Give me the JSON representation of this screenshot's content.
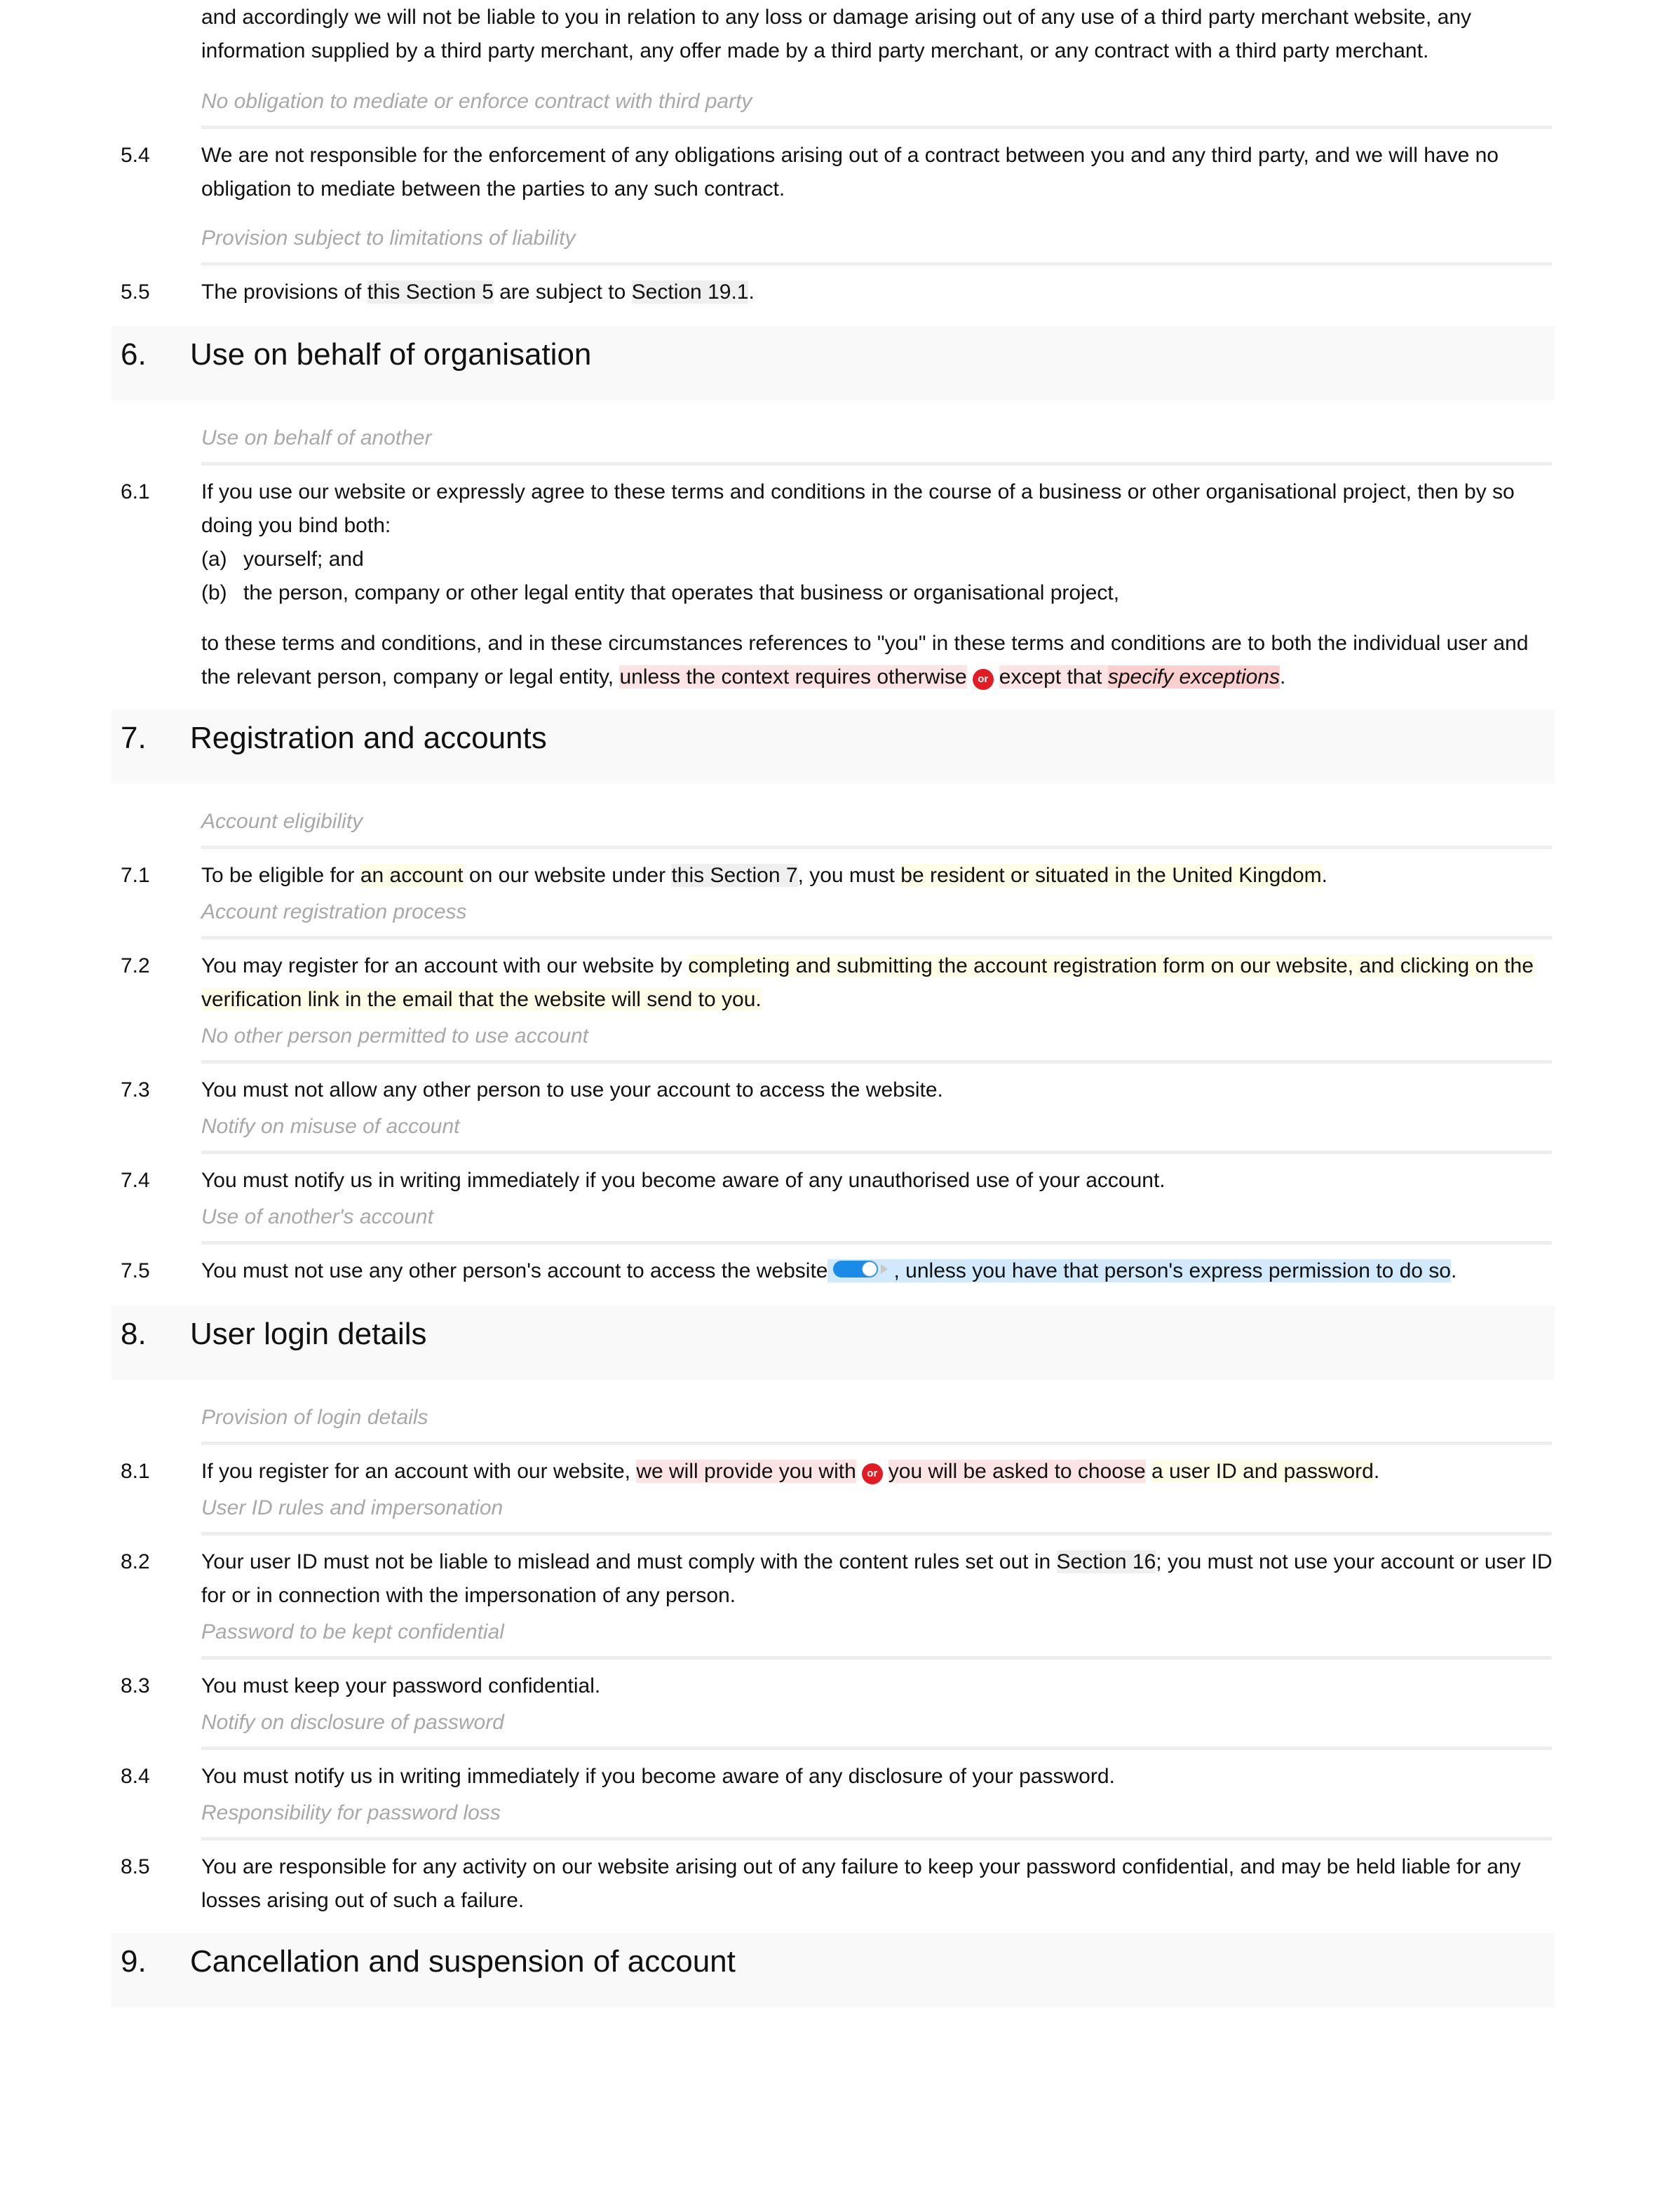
{
  "colors": {
    "guidance_text": "#a8a8a8",
    "divider": "#eeeeee",
    "heading_band": "#f9f9f9",
    "xref_highlight": "#efefef",
    "variable_highlight_yellow": "#fefde8",
    "option_highlight_red": "#fde4e4",
    "placeholder_highlight_red": "#fbcfcf",
    "optional_highlight_blue": "#d2e9fb",
    "or_badge": "#e31b23",
    "toggle_blue": "#1a8be6"
  },
  "intro": {
    "text": "and accordingly we will not be liable to you in relation to any loss or damage arising out of any use of a third party merchant website, any information supplied by a third party merchant, any offer made by a third party merchant, or any contract with a third party merchant."
  },
  "s5": {
    "c4": {
      "guidance": "No obligation to mediate or enforce contract with third party",
      "num": "5.4",
      "text": "We are not responsible for the enforcement of any obligations arising out of a contract between you and any third party, and we will have no obligation to mediate between the parties to any such contract."
    },
    "c5": {
      "guidance": "Provision subject to limitations of liability",
      "num": "5.5",
      "t1": "The provisions of ",
      "x1": "this Section 5",
      "t2": " are subject to ",
      "x2": "Section 19.1",
      "t3": "."
    }
  },
  "s6": {
    "num": "6.",
    "title": "Use on behalf of organisation",
    "c1": {
      "guidance": "Use on behalf of another",
      "num": "6.1",
      "text": "If you use our website or expressly agree to these terms and conditions in the course of a business or other organisational project, then by so doing you bind both:",
      "items": [
        {
          "label": "(a)",
          "text": "yourself; and"
        },
        {
          "label": "(b)",
          "text": "the person, company or other legal entity that operates that business or organisational project,"
        }
      ],
      "cont1": "to these terms and conditions, and in these circumstances references to \"you\" in these terms and conditions are to both the individual user and the relevant person, company or legal entity, ",
      "opt1": "unless the context requires otherwise",
      "or": "or",
      "opt2a": "except that ",
      "opt2b": "specify exceptions",
      "end": "."
    }
  },
  "s7": {
    "num": "7.",
    "title": "Registration and accounts",
    "c1": {
      "guidance": "Account eligibility",
      "num": "7.1",
      "t1": "To be eligible for ",
      "v1": "an account",
      "t2": " on our website under ",
      "x1": "this Section 7",
      "t3": ", you must ",
      "v2": "be resident or situated in the United Kingdom",
      "t4": "."
    },
    "c2": {
      "guidance": "Account registration process",
      "num": "7.2",
      "t1": "You may register for an account with our website by ",
      "v1": "completing and submitting the account registration form on our website, and clicking on the verification link in the email that the website will send to you."
    },
    "c3": {
      "guidance": "No other person permitted to use account",
      "num": "7.3",
      "text": "You must not allow any other person to use your account to access the website."
    },
    "c4": {
      "guidance": "Notify on misuse of account",
      "num": "7.4",
      "text": "You must notify us in writing immediately if you become aware of any unauthorised use of your account."
    },
    "c5": {
      "guidance": "Use of another's account",
      "num": "7.5",
      "t1": "You must not use any other person's account to access the website",
      "toggle_state": "on",
      "opt": ", unless you have that person's express permission to do so",
      "t2": "."
    }
  },
  "s8": {
    "num": "8.",
    "title": "User login details",
    "c1": {
      "guidance": "Provision of login details",
      "num": "8.1",
      "t1": "If you register for an account with our website, ",
      "opt1": "we will provide you with",
      "or": "or",
      "opt2": "you will be asked to choose",
      "t2": " ",
      "v1": "a user ID and password",
      "t3": "."
    },
    "c2": {
      "guidance": "User ID rules and impersonation",
      "num": "8.2",
      "t1": "Your user ID must not be liable to mislead and must comply with the content rules set out in ",
      "x1": "Section 16",
      "t2": "; you must not use your account or user ID for or in connection with the impersonation of any person."
    },
    "c3": {
      "guidance": "Password to be kept confidential",
      "num": "8.3",
      "text": "You must keep your password confidential."
    },
    "c4": {
      "guidance": "Notify on disclosure of password",
      "num": "8.4",
      "text": "You must notify us in writing immediately if you become aware of any disclosure of your password."
    },
    "c5": {
      "guidance": "Responsibility for password loss",
      "num": "8.5",
      "text": "You are responsible for any activity on our website arising out of any failure to keep your password confidential, and may be held liable for any losses arising out of such a failure."
    }
  },
  "s9": {
    "num": "9.",
    "title": "Cancellation and suspension of account"
  }
}
